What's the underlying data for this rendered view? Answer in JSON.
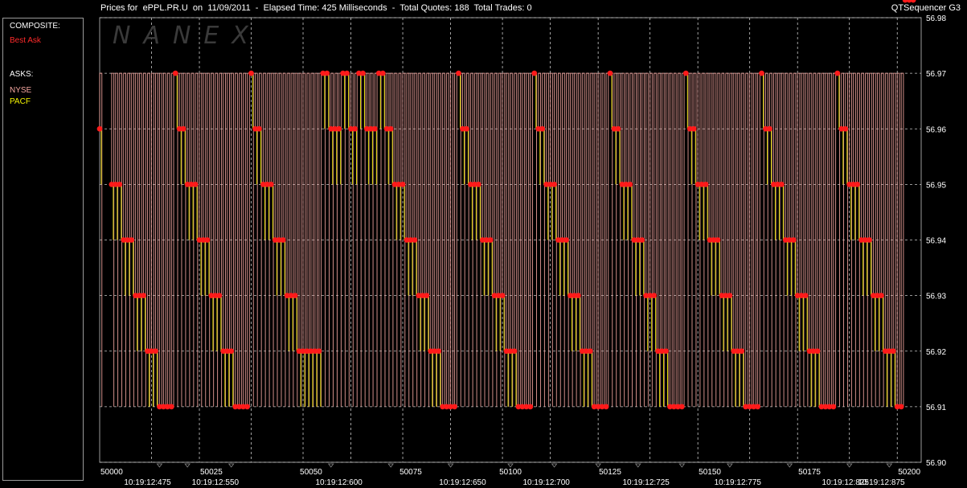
{
  "header": {
    "title": "Prices for  ePPL.PR.U  on  11/09/2011  -  Elapsed Time: 425 Milliseconds  -  Total Quotes: 188  Total Trades: 0",
    "app_name": "QTSequencer G3"
  },
  "watermark": "NANEX",
  "legend": {
    "composite_label": "COMPOSITE:",
    "best_ask_label": "Best Ask",
    "asks_label": "ASKS:",
    "nyse_label": "NYSE",
    "pacf_label": "PACF"
  },
  "colors": {
    "background": "#000000",
    "grid": "#c8c8c8",
    "nyse": "#f4a6a0",
    "pacf": "#f4f400",
    "best_ask": "#ff1a1a",
    "frame": "#9a9a9a"
  },
  "chart_data": {
    "type": "line",
    "step": true,
    "ylim": [
      56.9,
      56.98
    ],
    "yticks": [
      "56.98",
      "56.97",
      "56.96",
      "56.95",
      "56.94",
      "56.93",
      "56.92",
      "56.91",
      "56.90"
    ],
    "xlim": [
      49997,
      50203
    ],
    "xticks": [
      50000,
      50025,
      50050,
      50075,
      50100,
      50125,
      50150,
      50175,
      50200
    ],
    "time_labels": [
      {
        "x": 50009,
        "label": "10:19:12:475"
      },
      {
        "x": 50026,
        "label": "10:19:12:550"
      },
      {
        "x": 50057,
        "label": "10:19:12:600"
      },
      {
        "x": 50088,
        "label": "10:19:12:650"
      },
      {
        "x": 50109,
        "label": "10:19:12:700"
      },
      {
        "x": 50134,
        "label": "10:19:12:725"
      },
      {
        "x": 50157,
        "label": "10:19:12:775"
      },
      {
        "x": 50184,
        "label": "10:19:12:825"
      },
      {
        "x": 50193,
        "label": "10:19:12:875"
      }
    ],
    "grid": true,
    "series": [
      {
        "name": "NYSE",
        "note_values": "high/low alternation",
        "values": [
          56.97,
          56.96
        ]
      },
      {
        "name": "PACF",
        "values": [
          56.96,
          56.95
        ]
      }
    ],
    "best_ask": {
      "x": [
        49997,
        50000,
        50001,
        50002,
        50003,
        50004,
        50005,
        50006,
        50007,
        50008,
        50009,
        50010,
        50011,
        50012,
        50013,
        50014,
        50015,
        50016,
        50017,
        50018,
        50019,
        50020,
        50021,
        50022,
        50023,
        50024,
        50025,
        50026,
        50027,
        50028,
        50029,
        50030,
        50031,
        50032,
        50033,
        50034,
        50035,
        50036,
        50037,
        50038,
        50039,
        50040,
        50041,
        50042,
        50043,
        50044,
        50045,
        50046,
        50047,
        50048,
        50049,
        50050,
        50051,
        50052,
        50053,
        50054,
        50055,
        50056,
        50057,
        50058,
        50059,
        50060,
        50061,
        50062,
        50063,
        50064,
        50065,
        50066,
        50067,
        50068,
        50069,
        50070,
        50071,
        50072,
        50073,
        50074,
        50075,
        50076,
        50077,
        50078,
        50079,
        50080,
        50081,
        50082,
        50083,
        50084,
        50085,
        50086,
        50087,
        50088,
        50089,
        50090,
        50091,
        50092,
        50093,
        50094,
        50095,
        50096,
        50097,
        50098,
        50099,
        50100,
        50101,
        50102,
        50103,
        50104,
        50105,
        50106,
        50107,
        50108,
        50109,
        50110,
        50111,
        50112,
        50113,
        50114,
        50115,
        50116,
        50117,
        50118,
        50119,
        50120,
        50121,
        50122,
        50123,
        50124,
        50125,
        50126,
        50127,
        50128,
        50129,
        50130,
        50131,
        50132,
        50133,
        50134,
        50135,
        50136,
        50137,
        50138,
        50139,
        50140,
        50141,
        50142,
        50143,
        50144,
        50145,
        50146,
        50147,
        50148,
        50149,
        50150,
        50151,
        50152,
        50153,
        50154,
        50155,
        50156,
        50157,
        50158,
        50159,
        50160,
        50161,
        50162,
        50163,
        50164,
        50165,
        50166,
        50167,
        50168,
        50169,
        50170,
        50171,
        50172,
        50173,
        50174,
        50175,
        50176,
        50177,
        50178,
        50179,
        50180,
        50181,
        50182,
        50183,
        50184,
        50185,
        50186,
        50187,
        50188,
        50189,
        50190,
        50191,
        50192,
        50193,
        50194,
        50195,
        50196,
        50197,
        50198,
        50199,
        50200,
        50201
      ],
      "y": [
        56.96,
        56.95,
        56.95,
        56.95,
        56.94,
        56.94,
        56.94,
        56.93,
        56.93,
        56.93,
        56.92,
        56.92,
        56.92,
        56.91,
        56.91,
        56.91,
        56.91,
        56.97,
        56.96,
        56.96,
        56.95,
        56.95,
        56.95,
        56.94,
        56.94,
        56.94,
        56.93,
        56.93,
        56.93,
        56.92,
        56.92,
        56.92,
        56.91,
        56.91,
        56.91,
        56.91,
        56.97,
        56.96,
        56.96,
        56.95,
        56.95,
        56.95,
        56.94,
        56.94,
        56.94,
        56.93,
        56.93,
        56.93,
        56.92,
        56.92,
        56.92,
        56.92,
        56.92,
        56.92,
        56.97,
        56.97,
        56.96,
        56.96,
        56.96,
        56.97,
        56.97,
        56.96,
        56.96,
        56.97,
        56.97,
        56.96,
        56.96,
        56.96,
        56.97,
        56.97,
        56.96,
        56.96,
        56.95,
        56.95,
        56.95,
        56.94,
        56.94,
        56.94,
        56.93,
        56.93,
        56.93,
        56.92,
        56.92,
        56.92,
        56.91,
        56.91,
        56.91,
        56.91,
        56.97,
        56.96,
        56.96,
        56.95,
        56.95,
        56.95,
        56.94,
        56.94,
        56.94,
        56.93,
        56.93,
        56.93,
        56.92,
        56.92,
        56.92,
        56.91,
        56.91,
        56.91,
        56.91,
        56.97,
        56.96,
        56.96,
        56.95,
        56.95,
        56.95,
        56.94,
        56.94,
        56.94,
        56.93,
        56.93,
        56.93,
        56.92,
        56.92,
        56.92,
        56.91,
        56.91,
        56.91,
        56.91,
        56.97,
        56.96,
        56.96,
        56.95,
        56.95,
        56.95,
        56.94,
        56.94,
        56.94,
        56.93,
        56.93,
        56.93,
        56.92,
        56.92,
        56.92,
        56.91,
        56.91,
        56.91,
        56.91,
        56.97,
        56.96,
        56.96,
        56.95,
        56.95,
        56.95,
        56.94,
        56.94,
        56.94,
        56.93,
        56.93,
        56.93,
        56.92,
        56.92,
        56.92,
        56.91,
        56.91,
        56.91,
        56.91,
        56.97,
        56.96,
        56.96,
        56.95,
        56.95,
        56.95,
        56.94,
        56.94,
        56.94,
        56.93,
        56.93,
        56.93,
        56.92,
        56.92,
        56.92,
        56.91,
        56.91,
        56.91,
        56.91,
        56.97,
        56.96,
        56.96,
        56.95,
        56.95,
        56.95,
        56.94,
        56.94,
        56.94,
        56.93,
        56.93,
        56.93,
        56.92,
        56.92,
        56.92,
        56.91,
        56.91
      ]
    }
  }
}
